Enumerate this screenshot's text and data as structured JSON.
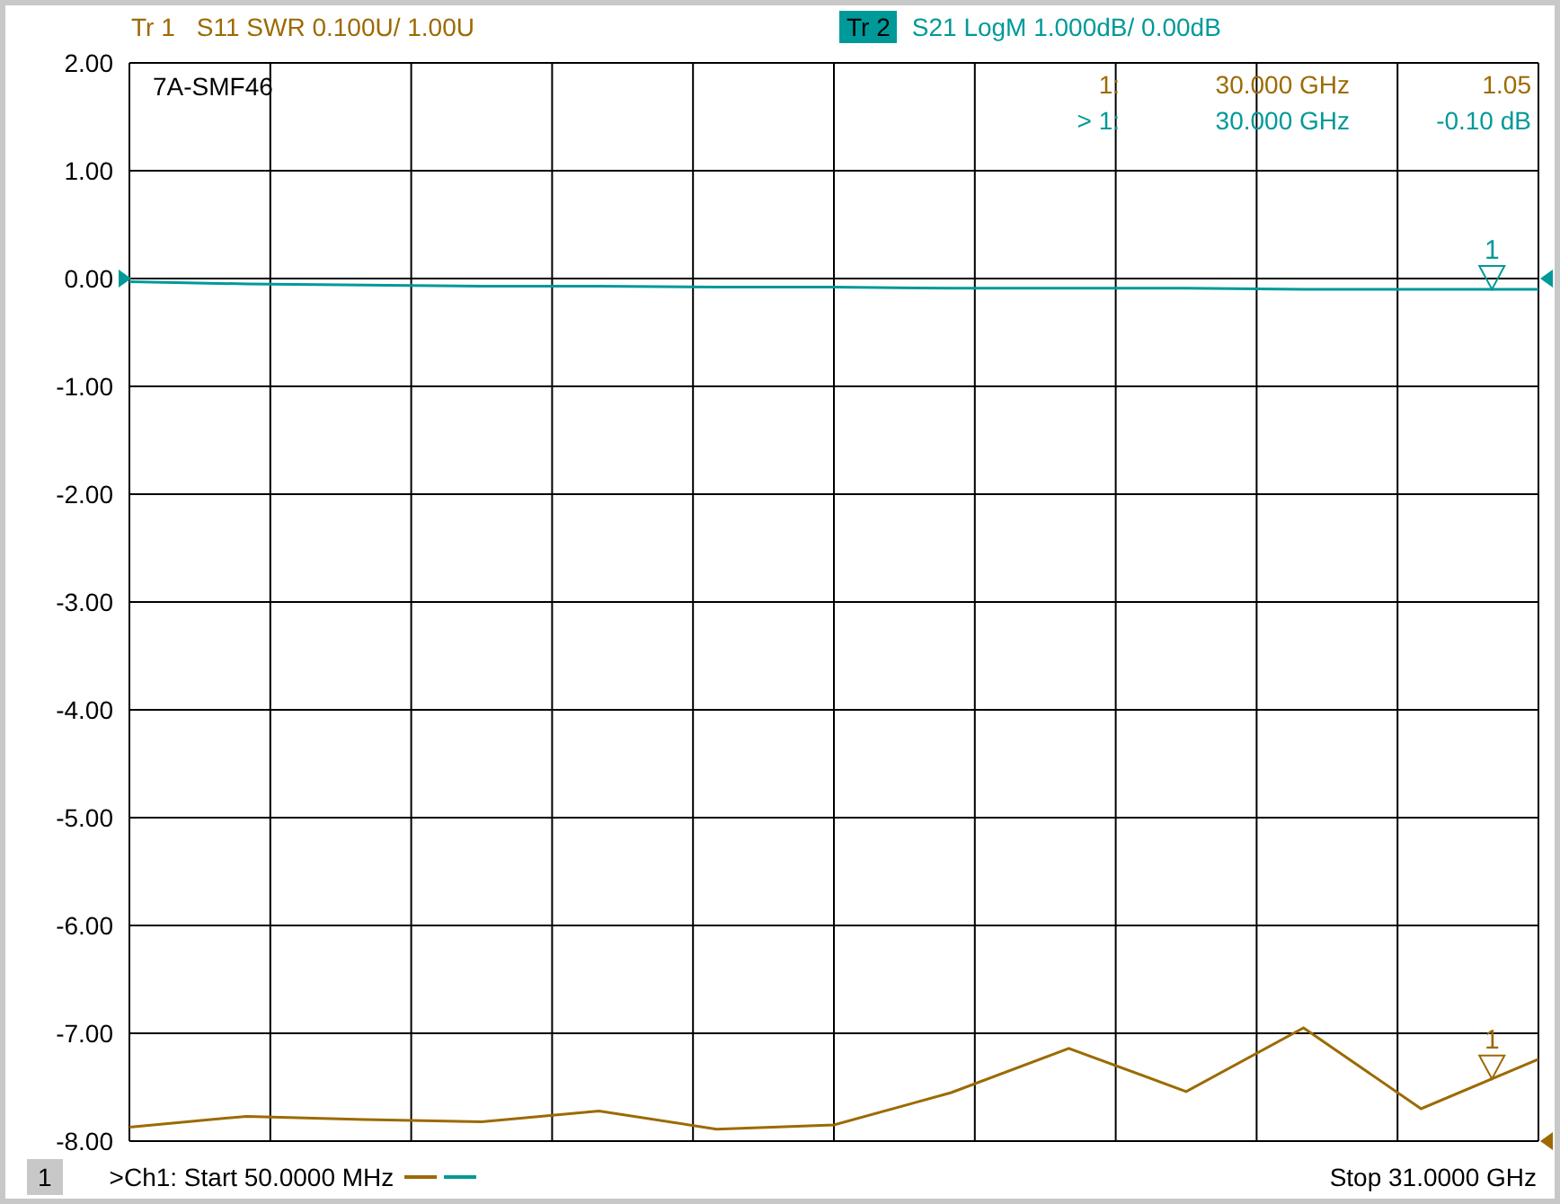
{
  "traces": [
    {
      "label": "Tr 1",
      "selected": false,
      "scale": "SWR 0.100U/  1.00U",
      "color": "#9c6a00"
    },
    {
      "label": "Tr 2",
      "selected": true,
      "scale": "LogM 1.000dB/  0.00dB",
      "color": "#009999"
    }
  ],
  "plot_title": "7A-SMF46",
  "marker_readouts": [
    {
      "label": "1:",
      "frequency": "30.000 GHz",
      "value": "1.05",
      "color": "#9c6a00"
    },
    {
      "label": "> 1:",
      "frequency": "30.000 GHz",
      "value": "-0.10 dB",
      "color": "#009999"
    }
  ],
  "trace_markers": [
    {
      "label": "1"
    },
    {
      "label": "1"
    }
  ],
  "chart_data": {
    "type": "line",
    "categories": [
      null,
      null,
      null,
      null,
      null,
      null,
      null,
      null,
      null,
      null,
      null,
      null,
      null
    ],
    "series": [
      {
        "name": "S11",
        "color": "#9c6a00",
        "values": [
          -7.87,
          -7.77,
          -7.8,
          -7.82,
          -7.72,
          -7.89,
          -7.85,
          -7.55,
          -7.14,
          -7.54,
          -6.95,
          -7.7,
          -7.24
        ]
      },
      {
        "name": "S21",
        "color": "#009999",
        "values": [
          -0.03,
          -0.05,
          -0.06,
          -0.07,
          -0.07,
          -0.08,
          -0.08,
          -0.09,
          -0.09,
          -0.09,
          -0.1,
          -0.1,
          -0.1
        ]
      }
    ],
    "ylim": [
      -8,
      2
    ],
    "grid": true,
    "yticks": [
      {
        "value": 2,
        "label": "2.00"
      },
      {
        "value": 1,
        "label": "1.00"
      },
      {
        "value": 0,
        "label": "0.00"
      },
      {
        "value": -1,
        "label": "-1.00"
      },
      {
        "value": -2,
        "label": "-2.00"
      },
      {
        "value": -3,
        "label": "-3.00"
      },
      {
        "value": -4,
        "label": "-4.00"
      },
      {
        "value": -5,
        "label": "-5.00"
      },
      {
        "value": -6,
        "label": "-6.00"
      },
      {
        "value": -7,
        "label": "-7.00"
      },
      {
        "value": -8,
        "label": "-8.00"
      }
    ]
  },
  "footer": {
    "channel": "1",
    "start": ">Ch1: Start  50.0000 MHz",
    "stop": "Stop  31.0000 GHz"
  }
}
